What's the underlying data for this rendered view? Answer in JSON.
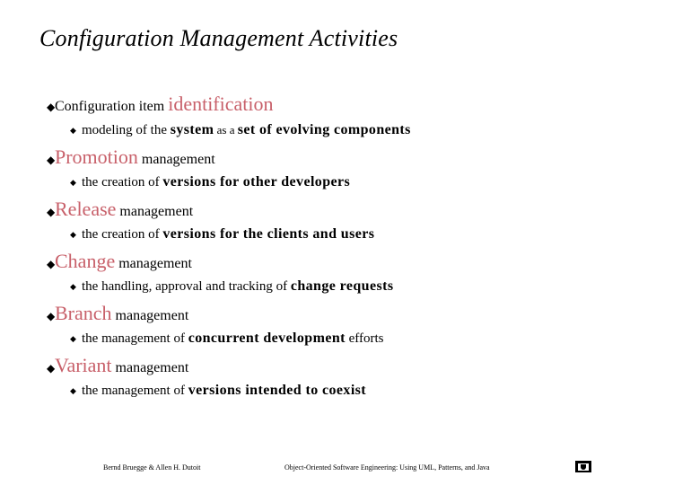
{
  "slide": {
    "title": "Configuration Management Activities",
    "accent_color": "#C8606A",
    "items": [
      {
        "pre": "Configuration item ",
        "accent": "identification",
        "post": "",
        "sub": [
          {
            "text": "modeling of the ",
            "style": "normal"
          },
          {
            "text": "system",
            "style": "bold"
          },
          {
            "text": " as a ",
            "style": "normal-small"
          },
          {
            "text": "set of evolving components",
            "style": "bold"
          }
        ]
      },
      {
        "pre": "",
        "accent": "Promotion",
        "post": " management",
        "sub": [
          {
            "text": "the creation of ",
            "style": "normal"
          },
          {
            "text": "versions for other developers",
            "style": "bold"
          }
        ]
      },
      {
        "pre": "",
        "accent": "Release",
        "post": " management",
        "sub": [
          {
            "text": "the creation of ",
            "style": "normal"
          },
          {
            "text": "versions for the clients and users",
            "style": "bold"
          }
        ]
      },
      {
        "pre": "",
        "accent": "Change",
        "post": " management",
        "sub": [
          {
            "text": "the handling, approval and tracking of ",
            "style": "normal"
          },
          {
            "text": "change requests",
            "style": "bold"
          }
        ]
      },
      {
        "pre": "",
        "accent": "Branch",
        "post": " management",
        "sub": [
          {
            "text": "the management of ",
            "style": "normal"
          },
          {
            "text": "concurrent development",
            "style": "bold"
          },
          {
            "text": " efforts",
            "style": "normal"
          }
        ]
      },
      {
        "pre": "",
        "accent": "Variant",
        "post": " management",
        "sub": [
          {
            "text": "the management of ",
            "style": "normal"
          },
          {
            "text": "versions intended to coexist",
            "style": "bold"
          }
        ]
      }
    ],
    "bullet_l1": "◆",
    "bullet_l2": "◆"
  },
  "footer": {
    "authors": "Bernd Bruegge & Allen H. Dutoit",
    "book": "Object-Oriented Software Engineering: Using UML, Patterns, and Java",
    "logo_icon": "tum-logo-icon"
  }
}
